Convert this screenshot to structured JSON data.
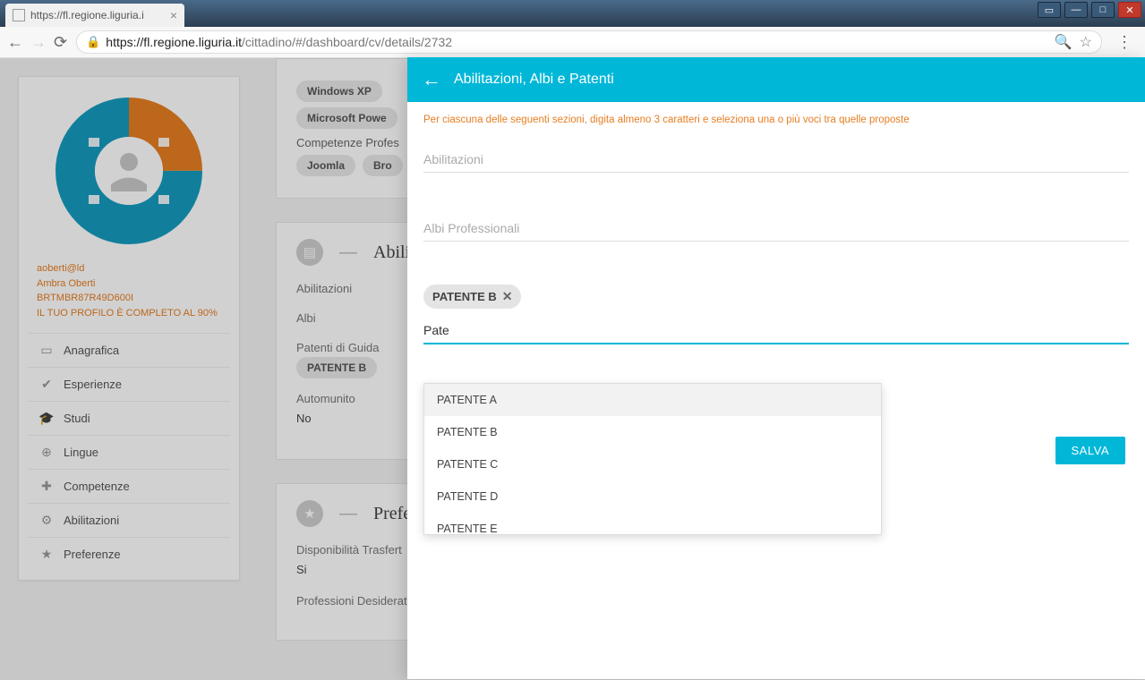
{
  "browser": {
    "tab_title": "https://fl.regione.liguria.i",
    "url_host": "https://fl.regione.liguria.it",
    "url_path": "/cittadino/#/dashboard/cv/details/2732"
  },
  "profile": {
    "lines": [
      "aoberti@ld",
      "Ambra Oberti",
      "BRTMBR87R49D600I",
      "IL TUO PROFILO È COMPLETO AL 90%"
    ]
  },
  "sidebar_nav": [
    {
      "icon": "▭",
      "label": "Anagrafica"
    },
    {
      "icon": "✔",
      "label": "Esperienze"
    },
    {
      "icon": "🎓",
      "label": "Studi"
    },
    {
      "icon": "⊕",
      "label": "Lingue"
    },
    {
      "icon": "✚",
      "label": "Competenze"
    },
    {
      "icon": "⚙",
      "label": "Abilitazioni"
    },
    {
      "icon": "★",
      "label": "Preferenze"
    }
  ],
  "bg_section1": {
    "pills_row1": [
      "Windows XP"
    ],
    "pills_row2": [
      "Microsoft Powe"
    ],
    "label": "Competenze Profes",
    "pills_row3": [
      "Joomla",
      "Bro"
    ]
  },
  "bg_section2": {
    "title": "Abili",
    "rows": [
      {
        "label": "Abilitazioni",
        "value": ""
      },
      {
        "label": "Albi",
        "value": ""
      },
      {
        "label": "Patenti di Guida",
        "pill": "PATENTE B"
      },
      {
        "label": "Automunito",
        "value": "No"
      }
    ]
  },
  "bg_section3": {
    "title": "Prefe",
    "rows": [
      {
        "label": "Disponibilità Trasfert",
        "value": "Si"
      },
      {
        "label": "Professioni Desiderat",
        "value": ""
      }
    ]
  },
  "panel": {
    "title": "Abilitazioni, Albi e Patenti",
    "help": "Per ciascuna delle seguenti sezioni, digita almeno 3 caratteri e seleziona una o più voci tra quelle proposte",
    "field1_placeholder": "Abilitazioni",
    "field2_placeholder": "Albi Professionali",
    "chip": "PATENTE B",
    "input_value": "Pate",
    "dropdown": [
      "PATENTE A",
      "PATENTE B",
      "PATENTE C",
      "PATENTE D",
      "PATENTE E"
    ],
    "save": "SALVA"
  }
}
